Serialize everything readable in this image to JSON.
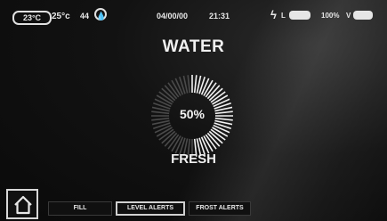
{
  "status_bar": {
    "inside_temp": "23°C",
    "outside_temp": "25°c",
    "humidity": "44",
    "humidity_icon": "water-drop-icon",
    "date": "04/00/00",
    "time": "21:31",
    "power_icon": "plug-icon",
    "power_label": "L",
    "battery_percent": "100%",
    "battery_label": "V"
  },
  "page": {
    "title": "WATER",
    "tank_type": "FRESH"
  },
  "gauge": {
    "value_text": "50%",
    "level": 0.5
  },
  "nav": {
    "home_icon": "home-icon",
    "tabs": [
      {
        "label": "FILL",
        "active": false
      },
      {
        "label": "LEVEL ALERTS",
        "active": true
      },
      {
        "label": "FROST ALERTS",
        "active": false
      }
    ]
  },
  "colors": {
    "background": "#0d0d0d",
    "foreground": "#e8e8e8",
    "gauge_tick_on": "#f2f2f2",
    "gauge_tick_off": "#4a4a4a"
  }
}
